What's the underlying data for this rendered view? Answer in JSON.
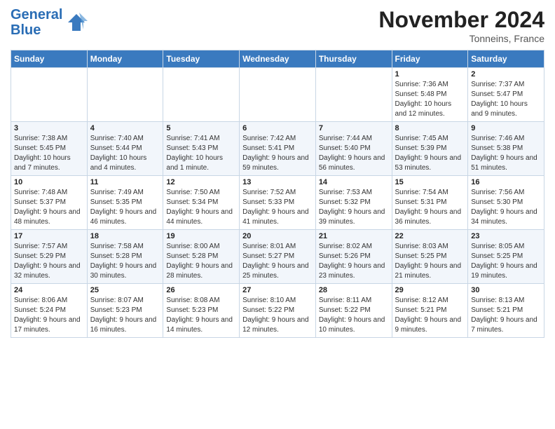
{
  "header": {
    "logo_line1": "General",
    "logo_line2": "Blue",
    "month": "November 2024",
    "location": "Tonneins, France"
  },
  "weekdays": [
    "Sunday",
    "Monday",
    "Tuesday",
    "Wednesday",
    "Thursday",
    "Friday",
    "Saturday"
  ],
  "weeks": [
    [
      {
        "day": "",
        "info": ""
      },
      {
        "day": "",
        "info": ""
      },
      {
        "day": "",
        "info": ""
      },
      {
        "day": "",
        "info": ""
      },
      {
        "day": "",
        "info": ""
      },
      {
        "day": "1",
        "info": "Sunrise: 7:36 AM\nSunset: 5:48 PM\nDaylight: 10 hours and 12 minutes."
      },
      {
        "day": "2",
        "info": "Sunrise: 7:37 AM\nSunset: 5:47 PM\nDaylight: 10 hours and 9 minutes."
      }
    ],
    [
      {
        "day": "3",
        "info": "Sunrise: 7:38 AM\nSunset: 5:45 PM\nDaylight: 10 hours and 7 minutes."
      },
      {
        "day": "4",
        "info": "Sunrise: 7:40 AM\nSunset: 5:44 PM\nDaylight: 10 hours and 4 minutes."
      },
      {
        "day": "5",
        "info": "Sunrise: 7:41 AM\nSunset: 5:43 PM\nDaylight: 10 hours and 1 minute."
      },
      {
        "day": "6",
        "info": "Sunrise: 7:42 AM\nSunset: 5:41 PM\nDaylight: 9 hours and 59 minutes."
      },
      {
        "day": "7",
        "info": "Sunrise: 7:44 AM\nSunset: 5:40 PM\nDaylight: 9 hours and 56 minutes."
      },
      {
        "day": "8",
        "info": "Sunrise: 7:45 AM\nSunset: 5:39 PM\nDaylight: 9 hours and 53 minutes."
      },
      {
        "day": "9",
        "info": "Sunrise: 7:46 AM\nSunset: 5:38 PM\nDaylight: 9 hours and 51 minutes."
      }
    ],
    [
      {
        "day": "10",
        "info": "Sunrise: 7:48 AM\nSunset: 5:37 PM\nDaylight: 9 hours and 48 minutes."
      },
      {
        "day": "11",
        "info": "Sunrise: 7:49 AM\nSunset: 5:35 PM\nDaylight: 9 hours and 46 minutes."
      },
      {
        "day": "12",
        "info": "Sunrise: 7:50 AM\nSunset: 5:34 PM\nDaylight: 9 hours and 44 minutes."
      },
      {
        "day": "13",
        "info": "Sunrise: 7:52 AM\nSunset: 5:33 PM\nDaylight: 9 hours and 41 minutes."
      },
      {
        "day": "14",
        "info": "Sunrise: 7:53 AM\nSunset: 5:32 PM\nDaylight: 9 hours and 39 minutes."
      },
      {
        "day": "15",
        "info": "Sunrise: 7:54 AM\nSunset: 5:31 PM\nDaylight: 9 hours and 36 minutes."
      },
      {
        "day": "16",
        "info": "Sunrise: 7:56 AM\nSunset: 5:30 PM\nDaylight: 9 hours and 34 minutes."
      }
    ],
    [
      {
        "day": "17",
        "info": "Sunrise: 7:57 AM\nSunset: 5:29 PM\nDaylight: 9 hours and 32 minutes."
      },
      {
        "day": "18",
        "info": "Sunrise: 7:58 AM\nSunset: 5:28 PM\nDaylight: 9 hours and 30 minutes."
      },
      {
        "day": "19",
        "info": "Sunrise: 8:00 AM\nSunset: 5:28 PM\nDaylight: 9 hours and 28 minutes."
      },
      {
        "day": "20",
        "info": "Sunrise: 8:01 AM\nSunset: 5:27 PM\nDaylight: 9 hours and 25 minutes."
      },
      {
        "day": "21",
        "info": "Sunrise: 8:02 AM\nSunset: 5:26 PM\nDaylight: 9 hours and 23 minutes."
      },
      {
        "day": "22",
        "info": "Sunrise: 8:03 AM\nSunset: 5:25 PM\nDaylight: 9 hours and 21 minutes."
      },
      {
        "day": "23",
        "info": "Sunrise: 8:05 AM\nSunset: 5:25 PM\nDaylight: 9 hours and 19 minutes."
      }
    ],
    [
      {
        "day": "24",
        "info": "Sunrise: 8:06 AM\nSunset: 5:24 PM\nDaylight: 9 hours and 17 minutes."
      },
      {
        "day": "25",
        "info": "Sunrise: 8:07 AM\nSunset: 5:23 PM\nDaylight: 9 hours and 16 minutes."
      },
      {
        "day": "26",
        "info": "Sunrise: 8:08 AM\nSunset: 5:23 PM\nDaylight: 9 hours and 14 minutes."
      },
      {
        "day": "27",
        "info": "Sunrise: 8:10 AM\nSunset: 5:22 PM\nDaylight: 9 hours and 12 minutes."
      },
      {
        "day": "28",
        "info": "Sunrise: 8:11 AM\nSunset: 5:22 PM\nDaylight: 9 hours and 10 minutes."
      },
      {
        "day": "29",
        "info": "Sunrise: 8:12 AM\nSunset: 5:21 PM\nDaylight: 9 hours and 9 minutes."
      },
      {
        "day": "30",
        "info": "Sunrise: 8:13 AM\nSunset: 5:21 PM\nDaylight: 9 hours and 7 minutes."
      }
    ]
  ]
}
